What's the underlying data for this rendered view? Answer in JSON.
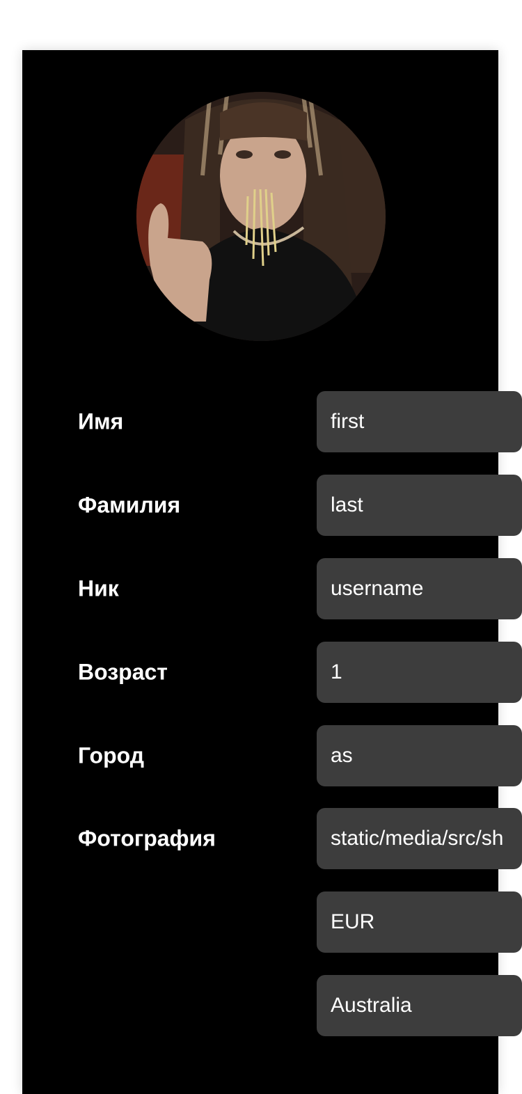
{
  "profile": {
    "avatar_icon": "profile-photo",
    "fields": [
      {
        "label": "Имя",
        "value": "first"
      },
      {
        "label": "Фамилия",
        "value": "last"
      },
      {
        "label": "Ник",
        "value": "username"
      },
      {
        "label": "Возраст",
        "value": "1"
      },
      {
        "label": "Город",
        "value": "as"
      },
      {
        "label": "Фотография",
        "value": "static/media/src/sh"
      }
    ],
    "extra_fields": [
      {
        "value": "EUR"
      },
      {
        "value": "Australia"
      }
    ]
  }
}
